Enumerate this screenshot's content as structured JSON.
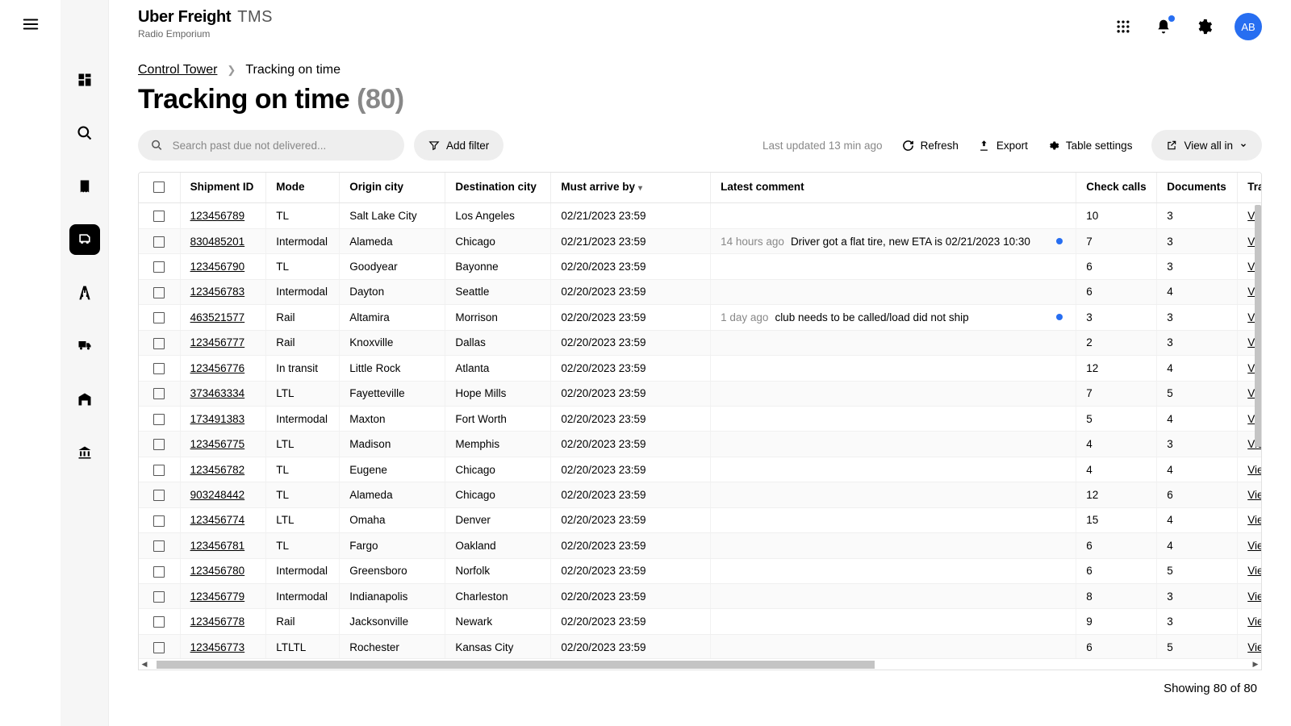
{
  "brand": {
    "main": "Uber Freight",
    "suffix": "TMS",
    "sub": "Radio Emporium"
  },
  "avatar": "AB",
  "breadcrumb": {
    "root": "Control Tower",
    "current": "Tracking on time"
  },
  "page": {
    "title": "Tracking on time",
    "count": "(80)"
  },
  "search": {
    "placeholder": "Search past due not delivered..."
  },
  "toolbar": {
    "add_filter": "Add filter",
    "last_updated": "Last updated 13 min ago",
    "refresh": "Refresh",
    "export": "Export",
    "table_settings": "Table settings",
    "view_all": "View all in"
  },
  "columns": {
    "shipment_id": "Shipment ID",
    "mode": "Mode",
    "origin": "Origin city",
    "dest": "Destination city",
    "arrive": "Must arrive by",
    "comment": "Latest comment",
    "calls": "Check calls",
    "docs": "Documents",
    "track": "Tracking d"
  },
  "view_link_label": "View in",
  "rows": [
    {
      "id": "123456789",
      "mode": "TL",
      "origin": "Salt Lake City",
      "dest": "Los Angeles",
      "arrive": "02/21/2023 23:59",
      "comment_age": "",
      "comment": "",
      "dot": false,
      "calls": "10",
      "docs": "3"
    },
    {
      "id": "830485201",
      "mode": "Intermodal",
      "origin": "Alameda",
      "dest": "Chicago",
      "arrive": "02/21/2023 23:59",
      "comment_age": "14 hours ago",
      "comment": "Driver got a flat tire, new ETA is 02/21/2023 10:30",
      "dot": true,
      "calls": "7",
      "docs": "3"
    },
    {
      "id": "123456790",
      "mode": "TL",
      "origin": "Goodyear",
      "dest": "Bayonne",
      "arrive": "02/20/2023 23:59",
      "comment_age": "",
      "comment": "",
      "dot": false,
      "calls": "6",
      "docs": "3"
    },
    {
      "id": "123456783",
      "mode": "Intermodal",
      "origin": "Dayton",
      "dest": "Seattle",
      "arrive": "02/20/2023 23:59",
      "comment_age": "",
      "comment": "",
      "dot": false,
      "calls": "6",
      "docs": "4"
    },
    {
      "id": "463521577",
      "mode": "Rail",
      "origin": "Altamira",
      "dest": "Morrison",
      "arrive": "02/20/2023 23:59",
      "comment_age": "1 day ago",
      "comment": "club needs to be called/load did not ship",
      "dot": true,
      "calls": "3",
      "docs": "3"
    },
    {
      "id": "123456777",
      "mode": "Rail",
      "origin": "Knoxville",
      "dest": "Dallas",
      "arrive": "02/20/2023 23:59",
      "comment_age": "",
      "comment": "",
      "dot": false,
      "calls": "2",
      "docs": "3"
    },
    {
      "id": "123456776",
      "mode": "In transit",
      "origin": "Little Rock",
      "dest": "Atlanta",
      "arrive": "02/20/2023 23:59",
      "comment_age": "",
      "comment": "",
      "dot": false,
      "calls": "12",
      "docs": "4"
    },
    {
      "id": "373463334",
      "mode": "LTL",
      "origin": "Fayetteville",
      "dest": "Hope Mills",
      "arrive": "02/20/2023 23:59",
      "comment_age": "",
      "comment": "",
      "dot": false,
      "calls": "7",
      "docs": "5"
    },
    {
      "id": "173491383",
      "mode": "Intermodal",
      "origin": "Maxton",
      "dest": "Fort Worth",
      "arrive": "02/20/2023 23:59",
      "comment_age": "",
      "comment": "",
      "dot": false,
      "calls": "5",
      "docs": "4"
    },
    {
      "id": "123456775",
      "mode": "LTL",
      "origin": "Madison",
      "dest": "Memphis",
      "arrive": "02/20/2023 23:59",
      "comment_age": "",
      "comment": "",
      "dot": false,
      "calls": "4",
      "docs": "3"
    },
    {
      "id": "123456782",
      "mode": "TL",
      "origin": "Eugene",
      "dest": "Chicago",
      "arrive": "02/20/2023 23:59",
      "comment_age": "",
      "comment": "",
      "dot": false,
      "calls": "4",
      "docs": "4"
    },
    {
      "id": "903248442",
      "mode": "TL",
      "origin": "Alameda",
      "dest": "Chicago",
      "arrive": "02/20/2023 23:59",
      "comment_age": "",
      "comment": "",
      "dot": false,
      "calls": "12",
      "docs": "6"
    },
    {
      "id": "123456774",
      "mode": "LTL",
      "origin": "Omaha",
      "dest": "Denver",
      "arrive": "02/20/2023 23:59",
      "comment_age": "",
      "comment": "",
      "dot": false,
      "calls": "15",
      "docs": "4"
    },
    {
      "id": "123456781",
      "mode": "TL",
      "origin": "Fargo",
      "dest": "Oakland",
      "arrive": "02/20/2023 23:59",
      "comment_age": "",
      "comment": "",
      "dot": false,
      "calls": "6",
      "docs": "4"
    },
    {
      "id": "123456780",
      "mode": "Intermodal",
      "origin": "Greensboro",
      "dest": "Norfolk",
      "arrive": "02/20/2023 23:59",
      "comment_age": "",
      "comment": "",
      "dot": false,
      "calls": "6",
      "docs": "5"
    },
    {
      "id": "123456779",
      "mode": "Intermodal",
      "origin": "Indianapolis",
      "dest": "Charleston",
      "arrive": "02/20/2023 23:59",
      "comment_age": "",
      "comment": "",
      "dot": false,
      "calls": "8",
      "docs": "3"
    },
    {
      "id": "123456778",
      "mode": "Rail",
      "origin": "Jacksonville",
      "dest": "Newark",
      "arrive": "02/20/2023 23:59",
      "comment_age": "",
      "comment": "",
      "dot": false,
      "calls": "9",
      "docs": "3"
    },
    {
      "id": "123456773",
      "mode": "LTLTL",
      "origin": "Rochester",
      "dest": "Kansas City",
      "arrive": "02/20/2023 23:59",
      "comment_age": "",
      "comment": "",
      "dot": false,
      "calls": "6",
      "docs": "5"
    }
  ],
  "footer": {
    "showing": "Showing 80 of 80"
  }
}
